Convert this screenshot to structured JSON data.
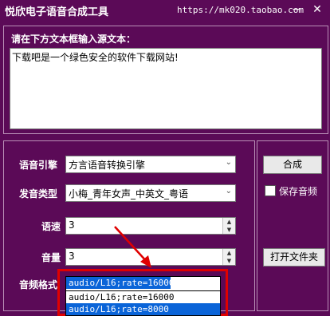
{
  "window": {
    "title": "悦欣电子语音合成工具",
    "url": "https://mk020.taobao.com",
    "close_glyph": "✕"
  },
  "source": {
    "label": "请在下方文本框输入源文本：",
    "text": "下载吧是一个绿色安全的软件下载网站!"
  },
  "settings": {
    "engine_label": "语音引擎",
    "engine_value": "方言语音转换引擎",
    "voice_label": "发音类型",
    "voice_value": "小梅_青年女声_中英文_粤语",
    "speed_label": "语速",
    "speed_value": "3",
    "volume_label": "音量",
    "volume_value": "3",
    "format_label": "音频格式",
    "format_value": "audio/L16;rate=16000",
    "format_options": [
      "audio/L16;rate=16000",
      "audio/L16;rate=8000"
    ]
  },
  "actions": {
    "synthesize_label": "合成",
    "save_audio_label": "保存音频",
    "open_folder_label": "打开文件夹"
  },
  "colors": {
    "background": "#5b0a57",
    "highlight": "#0a64d8",
    "annotation": "#e00000"
  }
}
